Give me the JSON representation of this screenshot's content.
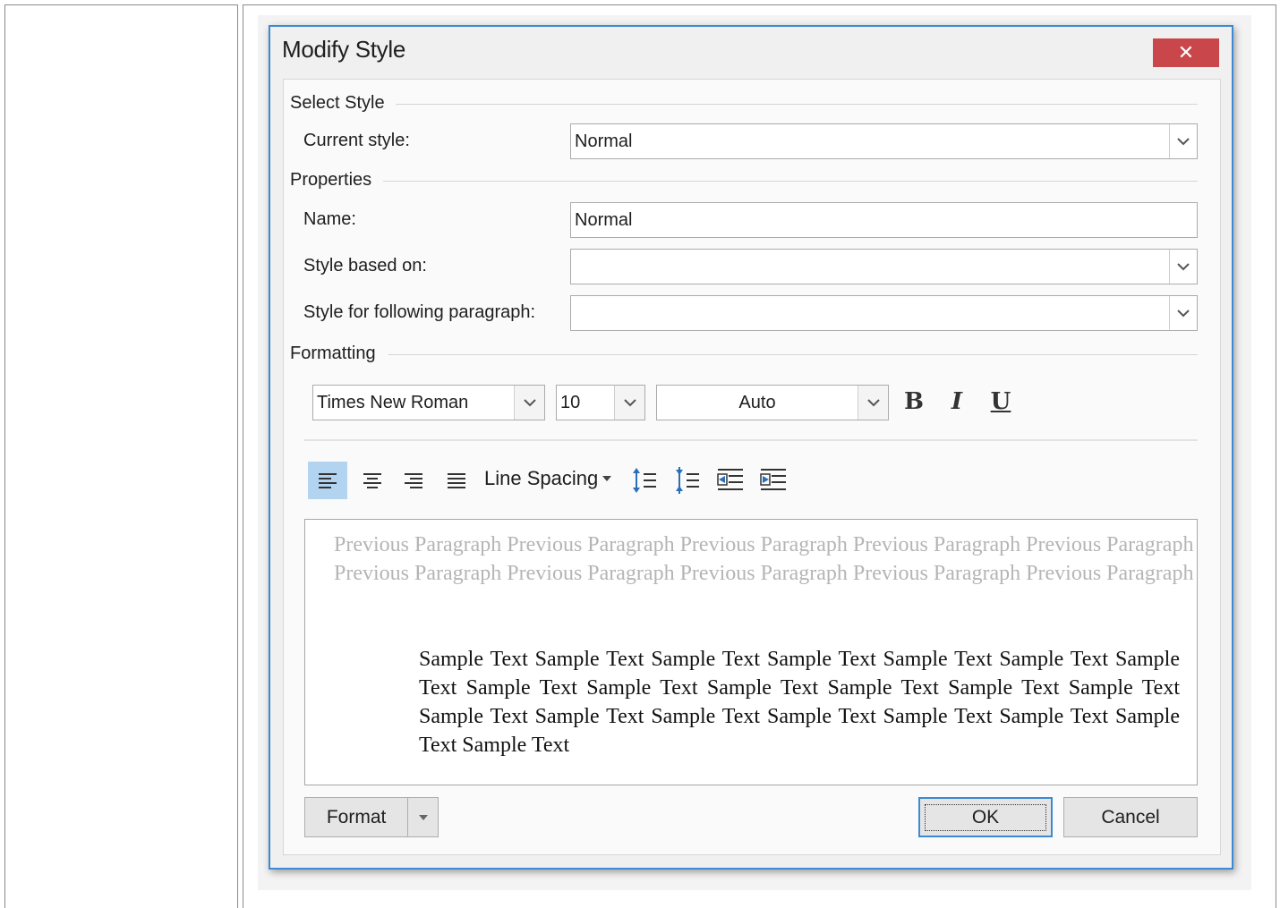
{
  "dialog": {
    "title": "Modify Style",
    "close_label": "✕"
  },
  "select_style": {
    "group_label": "Select Style",
    "current_style_label": "Current style:",
    "current_style_value": "Normal"
  },
  "properties": {
    "group_label": "Properties",
    "name_label": "Name:",
    "name_value": "Normal",
    "based_on_label": "Style based on:",
    "based_on_value": "",
    "following_label": "Style for following paragraph:",
    "following_value": ""
  },
  "formatting": {
    "group_label": "Formatting",
    "font_name": "Times New Roman",
    "font_size": "10",
    "font_color": "Auto",
    "bold_label": "B",
    "italic_label": "I",
    "underline_label": "U",
    "line_spacing_label": "Line Spacing",
    "active_alignment": "align-left"
  },
  "preview": {
    "previous_paragraph": "Previous Paragraph Previous Paragraph Previous Paragraph Previous Paragraph Previous Paragraph Previous Paragraph Previous Paragraph Previous Paragraph Previous Paragraph Previous Paragraph",
    "sample_text": "Sample Text Sample Text Sample Text Sample Text Sample Text Sample Text Sample Text Sample Text Sample Text Sample Text Sample Text Sample Text Sample Text Sample Text Sample Text Sample Text Sample Text Sample Text Sample Text Sample Text Sample Text"
  },
  "buttons": {
    "format_label": "Format",
    "ok_label": "OK",
    "cancel_label": "Cancel"
  },
  "colors": {
    "dialog_border": "#3c8ad4",
    "close_button": "#c9474a",
    "active_tool": "#b3d4f0"
  }
}
